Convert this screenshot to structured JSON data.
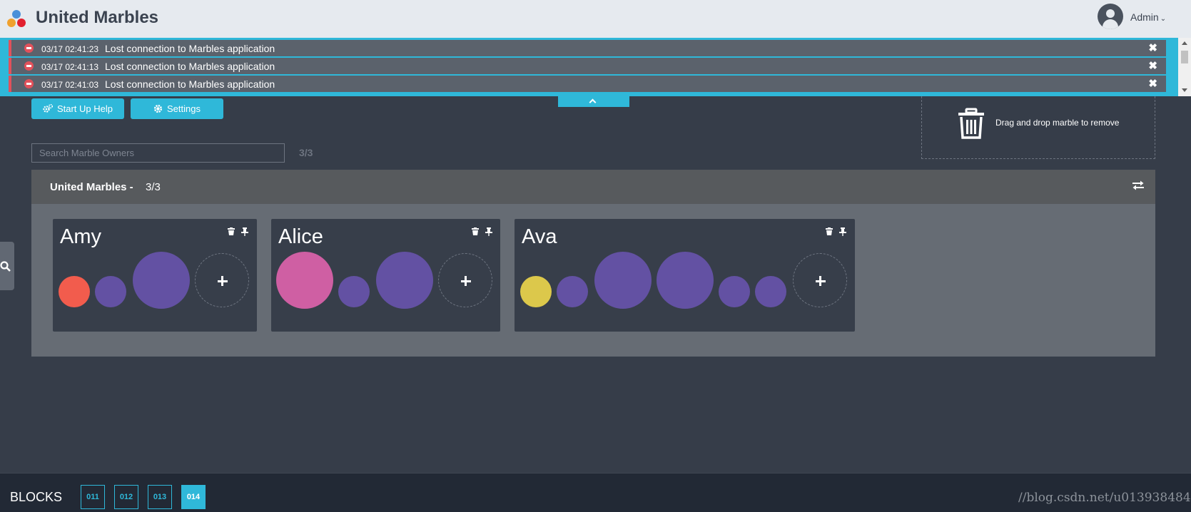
{
  "app": {
    "title": "United Marbles",
    "user": "Admin"
  },
  "notifications": [
    {
      "time": "03/17 02:41:23",
      "message": "Lost connection to Marbles application"
    },
    {
      "time": "03/17 02:41:13",
      "message": "Lost connection to Marbles application"
    },
    {
      "time": "03/17 02:41:03",
      "message": "Lost connection to Marbles application"
    }
  ],
  "toolbar": {
    "startup_help": "Start Up Help",
    "settings": "Settings"
  },
  "trash": {
    "label": "Drag and drop marble to remove"
  },
  "search": {
    "placeholder": "Search Marble Owners",
    "count": "3/3"
  },
  "company": {
    "name": "United Marbles -",
    "count": "3/3"
  },
  "owners": [
    {
      "name": "Amy",
      "marbles": [
        {
          "color": "#f25c4d",
          "size": "small"
        },
        {
          "color": "#6351a3",
          "size": "small"
        },
        {
          "color": "#6351a3",
          "size": "large"
        }
      ]
    },
    {
      "name": "Alice",
      "marbles": [
        {
          "color": "#cf5fa3",
          "size": "large"
        },
        {
          "color": "#6351a3",
          "size": "small"
        },
        {
          "color": "#6351a3",
          "size": "large"
        }
      ]
    },
    {
      "name": "Ava",
      "marbles": [
        {
          "color": "#dcc84b",
          "size": "small"
        },
        {
          "color": "#6351a3",
          "size": "small"
        },
        {
          "color": "#6351a3",
          "size": "large"
        },
        {
          "color": "#6351a3",
          "size": "large"
        },
        {
          "color": "#6351a3",
          "size": "small"
        },
        {
          "color": "#6351a3",
          "size": "small"
        }
      ]
    }
  ],
  "footer": {
    "label": "BLOCKS",
    "blocks": [
      "011",
      "012",
      "013",
      "014"
    ],
    "active_block": "014",
    "watermark": "//blog.csdn.net/u013938484"
  },
  "colors": {
    "accent": "#2fb8d9",
    "error": "#e2515b",
    "background": "#363d49"
  }
}
